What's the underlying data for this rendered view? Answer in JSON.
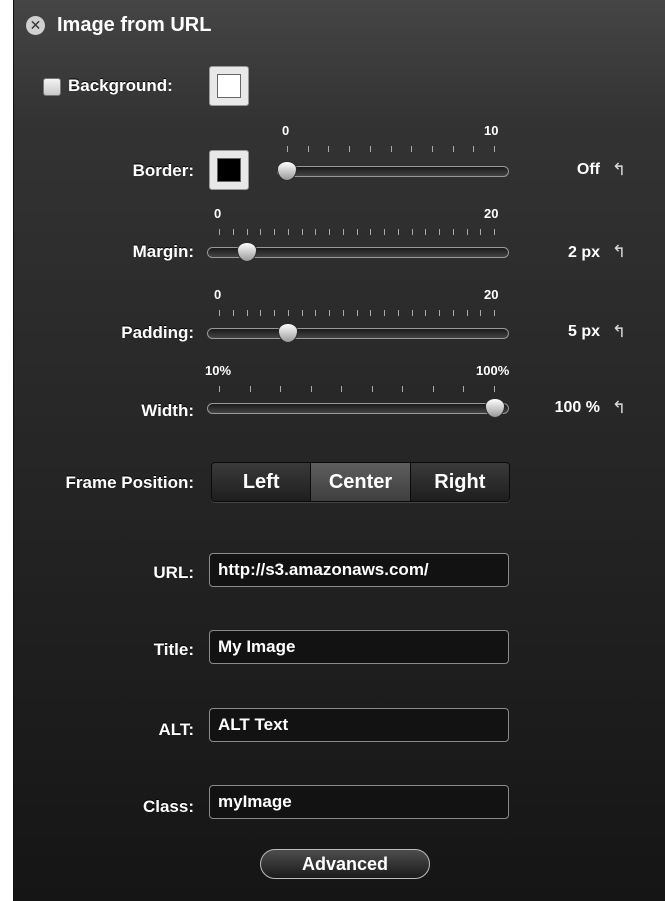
{
  "window": {
    "title": "Image from URL"
  },
  "background": {
    "label": "Background:",
    "checked": false,
    "swatch_color": "#ffffff"
  },
  "border": {
    "label": "Border:",
    "swatch_color": "#000000",
    "min_label": "0",
    "max_label": "10",
    "min": 0,
    "max": 10,
    "value": 0,
    "value_text": "Off"
  },
  "margin": {
    "label": "Margin:",
    "min_label": "0",
    "max_label": "20",
    "min": 0,
    "max": 20,
    "value": 2,
    "value_text": "2 px"
  },
  "padding": {
    "label": "Padding:",
    "min_label": "0",
    "max_label": "20",
    "min": 0,
    "max": 20,
    "value": 5,
    "value_text": "5 px"
  },
  "width": {
    "label": "Width:",
    "min_label": "10%",
    "max_label": "100%",
    "min": 10,
    "max": 100,
    "value": 100,
    "value_text": "100 %"
  },
  "frame_position": {
    "label": "Frame Position:",
    "options": [
      "Left",
      "Center",
      "Right"
    ],
    "selected": "Center"
  },
  "url": {
    "label": "URL:",
    "value": "http://s3.amazonaws.com/"
  },
  "title_field": {
    "label": "Title:",
    "value": "My Image"
  },
  "alt": {
    "label": "ALT:",
    "value": "ALT Text"
  },
  "class_field": {
    "label": "Class:",
    "value": "myImage"
  },
  "advanced_button": "Advanced",
  "icons": {
    "close": "close-icon",
    "reset": "reset-arrow-icon"
  }
}
